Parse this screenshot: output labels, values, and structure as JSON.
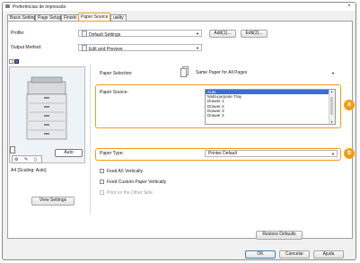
{
  "window": {
    "title": "Preferências de impressão",
    "close": "×"
  },
  "tabs": [
    {
      "label": "Basic Settings"
    },
    {
      "label": "Page Setup"
    },
    {
      "label": "Finishi"
    },
    {
      "label": "Paper Source",
      "active": true
    },
    {
      "label": "uality"
    }
  ],
  "profile": {
    "label": "Profile:",
    "value": "Default Settings",
    "add": "Add(1)...",
    "edit": "Edit(2)..."
  },
  "output": {
    "label": "Output Method:",
    "value": "Edit and Preview"
  },
  "preview": {
    "mode": "Auto",
    "info": "A4 [Scaling: Auto]",
    "view_settings": "View Settings"
  },
  "paper_selection": {
    "label": "Paper Selection:",
    "value": "Same Paper for All Pages"
  },
  "paper_source": {
    "label": "Paper Source:",
    "options": [
      "Auto",
      "Multi-purpose Tray",
      "Drawer 1",
      "Drawer 2",
      "Drawer 3",
      "Drawer 4"
    ],
    "selected": "Auto"
  },
  "paper_type": {
    "label": "Paper Type:",
    "value": "Printer Default"
  },
  "options": {
    "feed_a5": "Feed A5 Vertically",
    "feed_custom": "Feed Custom Paper Vertically",
    "print_other_side": "Print on the Other Side"
  },
  "restore": "Restore Defaults",
  "footer": {
    "ok": "OK",
    "cancel": "Cancelar",
    "help": "Ajuda"
  },
  "badges": {
    "a": "a",
    "b": "b"
  },
  "colors": {
    "highlight": "#f39c12",
    "selection": "#3b6fd1"
  }
}
